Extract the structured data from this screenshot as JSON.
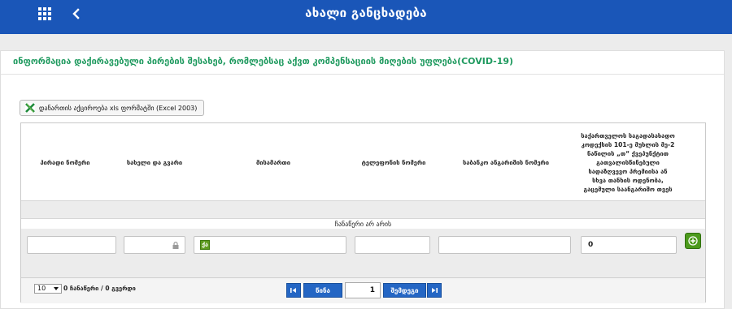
{
  "header": {
    "title": "ახალი განცხადება",
    "apps_icon": "apps-grid-icon",
    "back_icon": "chevron-left-icon",
    "bg_color": "#1a56b8"
  },
  "panel": {
    "title": "ინფორმაცია დაქირავებული პირების შესახებ, რომლებსაც აქვთ კომპენსაციის მიღების უფლება(COVID-19)",
    "title_color": "#1f9a5f"
  },
  "export": {
    "label": "დანართის აქციროება xls ფორმატში (Excel 2003)",
    "icon": "excel-icon"
  },
  "table": {
    "columns": [
      "პირადი ნომერი",
      "სახელი და გვარი",
      "მისამართი",
      "ტელეფონის ნომერი",
      "საბანკო ანგარიშის ნომერი",
      "საქართველოს საგადასახადო კოდექსის 101-ე მუხლის მე-2 ნაწილის „თ“ ქვეპუნქტით გათვალისწინებული სადაზღვევო პრემიისა ან სხვა თანხის ოდენობა, გაცემული საანგარიშო თვეს"
    ],
    "empty_message": "ჩანაწერი არ არის",
    "entry": {
      "personal_id": "",
      "full_name": "",
      "address": "",
      "phone": "",
      "bank_account": "",
      "premium_amount": "0"
    },
    "add_icon": "plus-circle-icon",
    "lock_icon": "lock-icon",
    "accent_color": "#4c9a1c"
  },
  "pager": {
    "page_size": "10",
    "record_info": "0 ჩანაწერი / 0 გვერდი",
    "first_icon": "first-page-icon",
    "prev_label": "წინა",
    "current_page": "1",
    "next_label": "შემდეგი",
    "last_icon": "last-page-icon",
    "button_color": "#2466c4"
  }
}
